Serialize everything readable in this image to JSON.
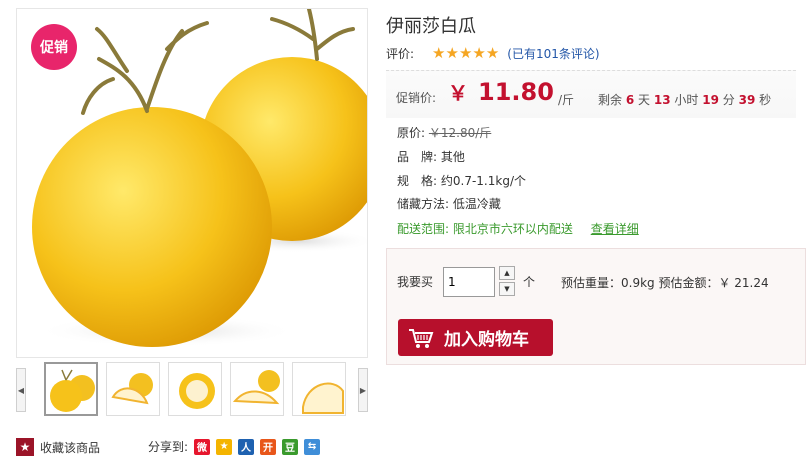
{
  "product": {
    "title": "伊丽莎白瓜",
    "promo_badge": "促销",
    "rating_label": "评价:",
    "stars": "★★★★★",
    "review_link": "(已有101条评论)"
  },
  "price": {
    "label": "促销价:",
    "currency": "￥",
    "value": "11.80",
    "unit": "/斤",
    "countdown_prefix": "剩余",
    "days": "6",
    "days_unit": "天",
    "hours": "13",
    "hours_unit": "小时",
    "minutes": "19",
    "minutes_unit": "分",
    "seconds": "39",
    "seconds_unit": "秒"
  },
  "info": {
    "original_label": "原价:",
    "original_value": "￥12.80/斤",
    "brand_label": "品　牌:",
    "brand_value": "其他",
    "spec_label": "规　格:",
    "spec_value": "约0.7-1.1kg/个",
    "storage_label": "储藏方法:",
    "storage_value": "低温冷藏",
    "delivery_label": "配送范围:",
    "delivery_value": "限北京市六环以内配送",
    "detail_link": "查看详细"
  },
  "buy": {
    "qty_label": "我要买",
    "qty_value": "1",
    "qty_unit": "个",
    "weight_text": "预估重量：0.9kg 预估金额：￥ 21.24",
    "cart_button": "加入购物车"
  },
  "footer": {
    "favorite": "收藏该商品",
    "share_label": "分享到:"
  },
  "share_icons": [
    {
      "name": "weibo-icon",
      "glyph": "微",
      "color": "#e6162d"
    },
    {
      "name": "qzone-icon",
      "glyph": "★",
      "color": "#f4b400"
    },
    {
      "name": "renren-icon",
      "glyph": "人",
      "color": "#1e61b0"
    },
    {
      "name": "kaixin-icon",
      "glyph": "开",
      "color": "#e8561a"
    },
    {
      "name": "douban-icon",
      "glyph": "豆",
      "color": "#3a9a2d"
    },
    {
      "name": "msn-icon",
      "glyph": "⇆",
      "color": "#3f8ed8"
    }
  ],
  "colors": {
    "accent": "#c3112f",
    "badge": "#e8256b",
    "link": "#2457a8",
    "green": "#3a9a2d",
    "star": "#f5a623"
  }
}
